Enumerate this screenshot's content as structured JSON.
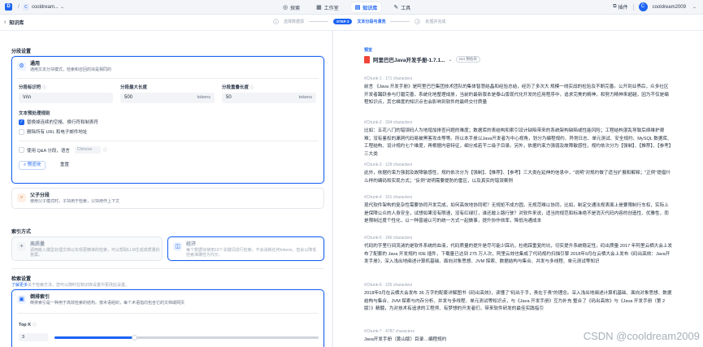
{
  "topbar": {
    "breadcrumb_sep": "/",
    "workspace_initial": "C",
    "workspace_name": "cooldream...",
    "nav": [
      {
        "icon": "compass-icon",
        "glyph": "◎",
        "label": "探索",
        "active": false
      },
      {
        "icon": "grid-icon",
        "glyph": "▦",
        "label": "工作室",
        "active": false
      },
      {
        "icon": "book-icon",
        "glyph": "▤",
        "label": "知识库",
        "active": true
      },
      {
        "icon": "wrench-icon",
        "glyph": "✎",
        "label": "工具",
        "active": false
      }
    ],
    "plugin_label": "插件",
    "avatar_initial": "C",
    "user_name": "cooldream2009"
  },
  "subbar": {
    "title": "知识库",
    "steps": [
      {
        "num": "1",
        "label": "选择数据源",
        "state": "done"
      },
      {
        "num": "STEP 2",
        "label": "文本分段与清洗",
        "state": "active"
      },
      {
        "num": "3",
        "label": "处理并完成",
        "state": "todo"
      }
    ]
  },
  "segmentation": {
    "section_title": "分段设置",
    "general": {
      "name": "通用",
      "desc": "通用文本分块模式，检索和召回的块是相同的",
      "delimiter_label": "分段标识符",
      "delimiter_value": "\\n\\n",
      "max_len_label": "分段最大长度",
      "max_len_value": "500",
      "max_len_unit": "tokens",
      "overlap_label": "分段重叠长度",
      "overlap_value": "50",
      "overlap_unit": "tokens",
      "rules_label": "文本预处理规则",
      "rule1": "替换掉连续的空格、换行符和制表符",
      "rule2": "删除所有 URL 和电子邮件地址",
      "qa_label": "使用 Q&A 分段，语言",
      "qa_lang": "Chinese",
      "preview_btn": "预览块",
      "reset_btn": "重置"
    },
    "parent_child": {
      "name": "父子分段",
      "desc": "使用父子模式时，子块用于检索，父块用作上下文"
    }
  },
  "index": {
    "section_title": "索引方式",
    "high_quality": {
      "name": "高质量",
      "desc": "调用嵌入模型处理文档以实现更精准的检索，可以帮助LLM生成高质量的答案。"
    },
    "economy": {
      "name": "经济",
      "desc": "每个数据块使用10个关键词进行检索，不会消耗任何tokens，但会以降低检索准确性为代价。"
    }
  },
  "retrieval": {
    "section_title": "检索设置",
    "helper_link": "了解更多",
    "helper_text": "关于检索方法，您可以随时在知识库设置中更改此设置。",
    "inverted": {
      "name": "倒排索引",
      "desc": "倒排索引是一种用于高效检索的结构。按术语组织，每个术语指向包含它的文档或网页"
    },
    "topk_label": "Top K",
    "topk_value": "3",
    "topk_fraction": 0.3
  },
  "preview": {
    "label": "预览",
    "doc_name": "阿里巴巴Java开发手册-1.7.1...",
    "doc_count": "244 预估块",
    "chunks": [
      {
        "head": "#Chunk-1 · 171 characters",
        "text": "前言 《Java 开发手册》是阿里巴巴集团技术团队的集体智慧结晶和经验总结，经历了多次大 规模一线实战的检验及不断完善。公开到业界后，众多社区开发者踊跃参与打磨完善，系统化地整理成册，当前的最新版本是泰山版现代化开发的应用程序中，追求完美的精神，和努力精神来超越，因为不仅是编程知识点，其它维度的知识点也会影响到软件的最终交付质量"
      },
      {
        "head": "#Chunk-2 · 334 characters",
        "text": "比如：五花八门的错误码人为地增加排查问题的难度；数据库的表结构和索引设计缺陷带来的系统架构缺陷或性能风险；工程结构混乱导致后续维护艰难；没有鉴权的漏洞代码易被黑客攻击等等。所以本手册以Java开发者为中心视角，划分为编程规约、异常日志、单元测试、安全规约、MySQL 数据库、工程结构、设计规约七个维度，再根据内容特征，细分成若干二级子目录。另外，依据约束力强弱及故障敏感性，规约依次分为【强制】、【推荐】、【参考】三大类"
      },
      {
        "head": "#Chunk-3 · 129 characters",
        "text": "此外，依据约束力强弱及故障敏感性，规约依次分为【强制】、【推荐】、【参考】三大类在延伸的信息中，\"说明\"对规约做了适当扩展和解释；\"正例\"提倡什么样的编码和实现方式；\"反例\"说明需要提防的雷区，以及真实的错误案例"
      },
      {
        "head": "#Chunk-4 · 161 characters",
        "text": "现代软件架构的复杂性需要协同开发完成，如何高效地协同呢？无规矩不成方圆，无规范难以协同，比如，制定交通法规表面上是要限制行车权，实际上是保障公众的人身安全，试想如果没有限速，没有红绿灯，谁还敢上路行驶？对软件来说，适当的规范和标准绝不是消灭代码内容的创造性、优雅性，而是限制过度个性化，以一种普遍认可的统一方式一起做事，提升协作效率，降低沟通成本"
      },
      {
        "head": "#Chunk-5 · 246 characters",
        "text": "代码的字里行间流淌的是软件系统的血液，代码质量的提升是尽可能少踩坑，杜绝踩重复的坑，切实提升系统稳定性，码出质量 2017 年阿里云栖大会上发布了配套的 Java 开发规约 IDE 插件，下载量已达到 275 万人次，阿里云效也集成了代码规约扫描引擎 2018年9月在云栖大会上发布《码出高效：Java开发手册》，深入浅出地阐述计算机基础、面向对象思想、JVM 探索、数据结构与集合、并发与多线程、单元测试等知识"
      },
      {
        "head": "#Chunk-6 · 225 characters",
        "text": "2018年9月在云栖大会发布 36 万字的配套详解图书《码出高效》，读懂了\"码出于手，责在于责\"的理念。深入浅出地阐述计算机基础、面向对象思想、数据结构与集合、JVM 探索与内存分析、并发与多线程、单元测试等知识点，与《Java 开发手册》互为补充 整合了《码出高效》与《Java 开发手册（第 2 版）》精髓，为对技术有追求的工程师、有梦想的开发者们，带来软件研发的最佳实践指引"
      },
      {
        "head": "#Chunk-7 · 4787 characters",
        "text": "Java开发手册（黄山版）目录…编程规约"
      }
    ]
  },
  "watermark": "CSDN @cooldream2009",
  "colors": {
    "accent": "#1c64f2",
    "page_bg": "#f3f5f8",
    "card_border": "#e4e7ec",
    "pdf": "#f04438"
  }
}
